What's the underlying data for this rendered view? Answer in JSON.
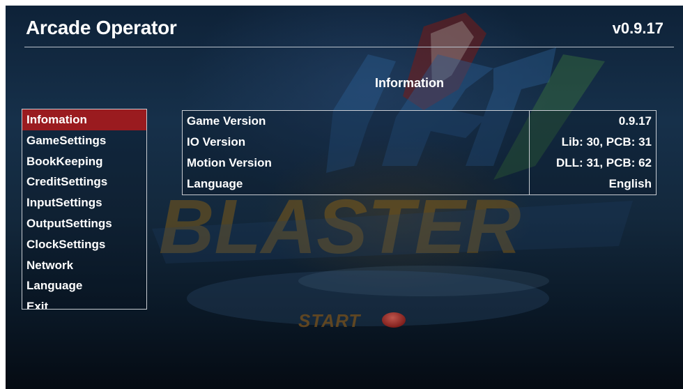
{
  "header": {
    "title": "Arcade Operator",
    "version": "v0.9.17"
  },
  "page": {
    "heading": "Information"
  },
  "menu": {
    "items": [
      {
        "label": "Infomation",
        "selected": true
      },
      {
        "label": "GameSettings",
        "selected": false
      },
      {
        "label": "BookKeeping",
        "selected": false
      },
      {
        "label": "CreditSettings",
        "selected": false
      },
      {
        "label": "InputSettings",
        "selected": false
      },
      {
        "label": "OutputSettings",
        "selected": false
      },
      {
        "label": "ClockSettings",
        "selected": false
      },
      {
        "label": "Network",
        "selected": false
      },
      {
        "label": "Language",
        "selected": false
      },
      {
        "label": "Exit",
        "selected": false
      }
    ]
  },
  "info": {
    "rows": [
      {
        "key": "Game Version",
        "value": "0.9.17"
      },
      {
        "key": "IO Version",
        "value": "Lib: 30, PCB: 31"
      },
      {
        "key": "Motion Version",
        "value": "DLL: 31, PCB: 62"
      },
      {
        "key": "Language",
        "value": "English"
      }
    ]
  },
  "background": {
    "logo_text": "BLASTER",
    "start_text": "START"
  },
  "colors": {
    "selected_bg": "#9a1b1f",
    "border": "#c8ccd2",
    "text": "#ffffff"
  }
}
